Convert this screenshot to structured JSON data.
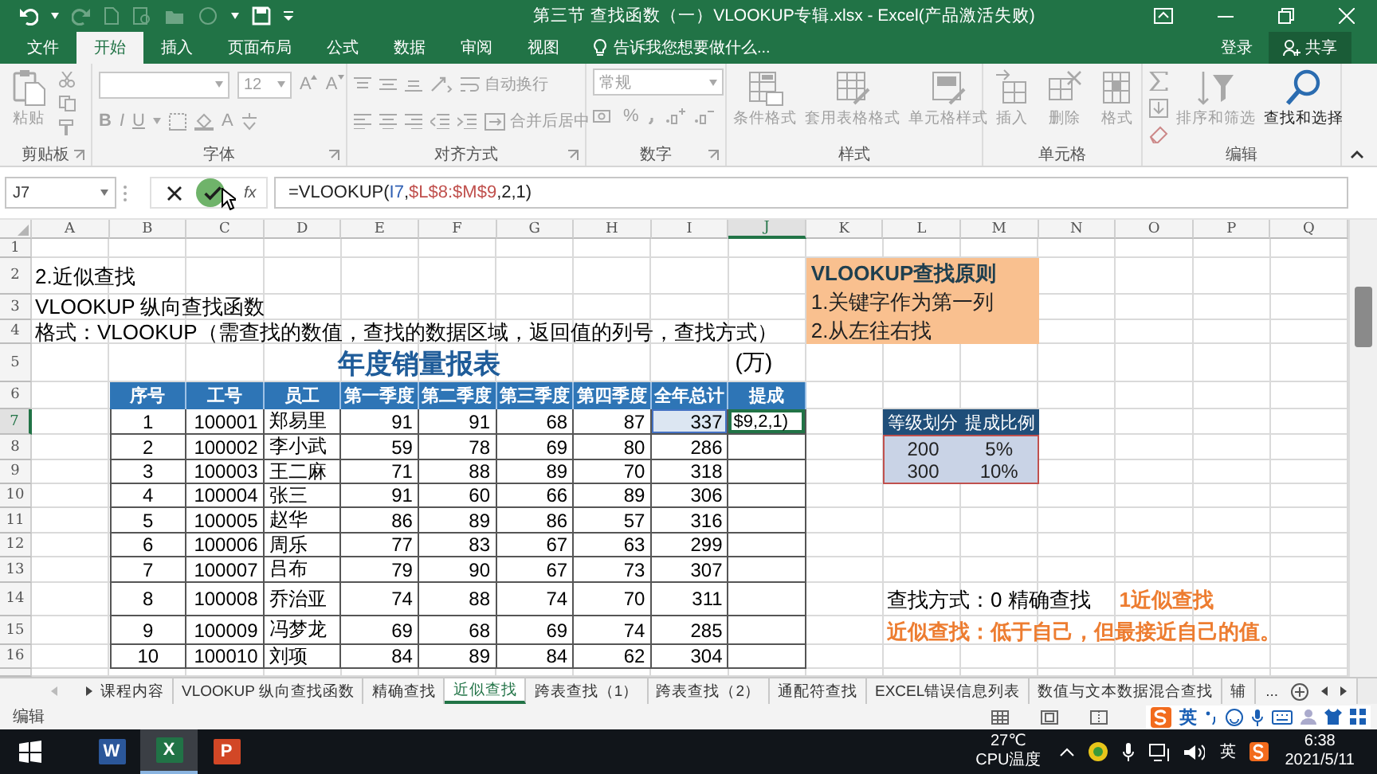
{
  "title_bar": {
    "title": "第三节 查找函数（一）VLOOKUP专辑.xlsx - Excel(产品激活失败)"
  },
  "ribbon": {
    "tabs": [
      {
        "label": "文件",
        "selected": false
      },
      {
        "label": "开始",
        "selected": true
      },
      {
        "label": "插入",
        "selected": false
      },
      {
        "label": "页面布局",
        "selected": false
      },
      {
        "label": "公式",
        "selected": false
      },
      {
        "label": "数据",
        "selected": false
      },
      {
        "label": "审阅",
        "selected": false
      },
      {
        "label": "视图",
        "selected": false
      }
    ],
    "tell_me": "告诉我您想要做什么...",
    "sign_in": "登录",
    "share": "共享",
    "groups": [
      {
        "kind": "clipboard",
        "label": "剪贴板",
        "buttons": [
          {
            "label": "粘贴",
            "disabled": true
          }
        ]
      },
      {
        "kind": "font",
        "label": "字体",
        "disabled": true,
        "font_size": "12",
        "size_buttons": [
          "A",
          "A"
        ],
        "format_buttons": [
          "B",
          "I",
          "U"
        ],
        "color_button": "A"
      },
      {
        "kind": "alignment",
        "label": "对齐方式",
        "buttons": [
          {
            "label": "自动换行",
            "disabled": true
          },
          {
            "label": "合并后居中",
            "disabled": true
          }
        ]
      },
      {
        "kind": "number",
        "label": "数字",
        "disabled": true,
        "format": "常规",
        "percent": "%"
      },
      {
        "kind": "styles",
        "label": "样式",
        "buttons": [
          {
            "label": "条件格式",
            "disabled": true
          },
          {
            "label": "套用表格格式",
            "disabled": true
          },
          {
            "label": "单元格样式",
            "disabled": true
          }
        ]
      },
      {
        "kind": "cells",
        "label": "单元格",
        "buttons": [
          {
            "label": "插入",
            "disabled": true
          },
          {
            "label": "删除",
            "disabled": true
          },
          {
            "label": "格式",
            "disabled": true
          }
        ]
      },
      {
        "kind": "editing",
        "label": "编辑",
        "buttons": [
          {
            "label": "排序和筛选",
            "disabled": true
          },
          {
            "label": "查找和选择",
            "disabled": false
          }
        ]
      }
    ]
  },
  "formula_bar": {
    "name_box": "J7",
    "function_button": "fx",
    "formula": [
      {
        "text": "=VLOOKUP("
      },
      {
        "text": "I7",
        "color": "#2f5fb3"
      },
      {
        "text": ","
      },
      {
        "text": "$L$8:$M$9",
        "color": "#c0504d"
      },
      {
        "text": ",2,1)"
      }
    ]
  },
  "sheet": {
    "column_headers": [
      {
        "label": "A",
        "selected": false
      },
      {
        "label": "B",
        "selected": false
      },
      {
        "label": "C",
        "selected": false
      },
      {
        "label": "D",
        "selected": false
      },
      {
        "label": "E",
        "selected": false
      },
      {
        "label": "F",
        "selected": false
      },
      {
        "label": "G",
        "selected": false
      },
      {
        "label": "H",
        "selected": false
      },
      {
        "label": "I",
        "selected": false
      },
      {
        "label": "J",
        "selected": true
      },
      {
        "label": "K",
        "selected": false
      },
      {
        "label": "L",
        "selected": false
      },
      {
        "label": "M",
        "selected": false
      },
      {
        "label": "N",
        "selected": false
      },
      {
        "label": "O",
        "selected": false
      },
      {
        "label": "P",
        "selected": false
      },
      {
        "label": "Q",
        "selected": false
      }
    ],
    "row_headers": [
      {
        "label": "1",
        "selected": false
      },
      {
        "label": "2",
        "selected": false
      },
      {
        "label": "3",
        "selected": false
      },
      {
        "label": "4",
        "selected": false
      },
      {
        "label": "5",
        "selected": false
      },
      {
        "label": "6",
        "selected": false
      },
      {
        "label": "7",
        "selected": true
      },
      {
        "label": "8",
        "selected": false
      },
      {
        "label": "9",
        "selected": false
      },
      {
        "label": "10",
        "selected": false
      },
      {
        "label": "11",
        "selected": false
      },
      {
        "label": "12",
        "selected": false
      },
      {
        "label": "13",
        "selected": false
      },
      {
        "label": "14",
        "selected": false
      },
      {
        "label": "15",
        "selected": false
      },
      {
        "label": "16",
        "selected": false
      }
    ],
    "notes": [
      "2.近似查找",
      "VLOOKUP 纵向查找函数",
      "格式：VLOOKUP（需查找的数值，查找的数据区域，返回值的列号，查找方式）"
    ],
    "report": {
      "title": "年度销量报表",
      "unit": "(万)",
      "columns": [
        "序号",
        "工号",
        "员工",
        "第一季度",
        "第二季度",
        "第三季度",
        "第四季度",
        "全年总计",
        "提成"
      ],
      "rows": [
        {
          "values": [
            "1",
            "100001",
            "郑易里",
            "91",
            "91",
            "68",
            "87",
            "337"
          ],
          "total_referenced": true,
          "commission": "$9,2,1)",
          "commission_active": true
        },
        {
          "values": [
            "2",
            "100002",
            "李小武",
            "59",
            "78",
            "69",
            "80",
            "286"
          ],
          "total_referenced": false,
          "commission_active": false
        },
        {
          "values": [
            "3",
            "100003",
            "王二麻",
            "71",
            "88",
            "89",
            "70",
            "318"
          ],
          "total_referenced": false,
          "commission_active": false
        },
        {
          "values": [
            "4",
            "100004",
            "张三",
            "91",
            "60",
            "66",
            "89",
            "306"
          ],
          "total_referenced": false,
          "commission_active": false
        },
        {
          "values": [
            "5",
            "100005",
            "赵华",
            "86",
            "89",
            "86",
            "57",
            "316"
          ],
          "total_referenced": false,
          "commission_active": false
        },
        {
          "values": [
            "6",
            "100006",
            "周乐",
            "77",
            "83",
            "67",
            "63",
            "299"
          ],
          "total_referenced": false,
          "commission_active": false
        },
        {
          "values": [
            "7",
            "100007",
            "吕布",
            "79",
            "90",
            "67",
            "73",
            "307"
          ],
          "total_referenced": false,
          "commission_active": false
        },
        {
          "values": [
            "8",
            "100008",
            "乔治亚",
            "74",
            "88",
            "74",
            "70",
            "311"
          ],
          "total_referenced": false,
          "commission_active": false
        },
        {
          "values": [
            "9",
            "100009",
            "冯梦龙",
            "69",
            "68",
            "69",
            "74",
            "285"
          ],
          "total_referenced": false,
          "commission_active": false
        },
        {
          "values": [
            "10",
            "100010",
            "刘项",
            "84",
            "89",
            "84",
            "62",
            "304"
          ],
          "total_referenced": false,
          "commission_active": false
        }
      ]
    },
    "principle_box": {
      "title": "VLOOKUP查找原则",
      "lines": [
        "1.关键字作为第一列",
        "2.从左往右找"
      ]
    },
    "grade_table": {
      "columns": [
        "等级划分",
        "提成比例"
      ],
      "rows": [
        [
          "200",
          "5%"
        ],
        [
          "300",
          "10%"
        ]
      ],
      "referenced": true
    },
    "lookup_notes": {
      "mode_label": "查找方式：0 精确查找",
      "approx_label": "1近似查找",
      "rule": "近似查找：低于自己，但最接近自己的值。"
    }
  },
  "sheet_tabs": {
    "tabs": [
      {
        "label": "课程内容",
        "selected": false
      },
      {
        "label": "VLOOKUP 纵向查找函数",
        "selected": false
      },
      {
        "label": "精确查找",
        "selected": false
      },
      {
        "label": "近似查找",
        "selected": true
      },
      {
        "label": "跨表查找（1）",
        "selected": false
      },
      {
        "label": "跨表查找（2）",
        "selected": false
      },
      {
        "label": "通配符查找",
        "selected": false
      },
      {
        "label": "EXCEL错误信息列表",
        "selected": false
      },
      {
        "label": "数值与文本数据混合查找",
        "selected": false
      },
      {
        "label": "辅",
        "selected": false
      }
    ],
    "more": "..."
  },
  "status_bar": {
    "mode": "编辑",
    "ime": "英"
  },
  "taskbar": {
    "apps": [
      {
        "glyph": "W",
        "color": "#2b579a",
        "selected": false
      },
      {
        "glyph": "X",
        "color": "#217346",
        "selected": true
      },
      {
        "glyph": "P",
        "color": "#d24726",
        "selected": false
      }
    ],
    "temperature": "27℃",
    "sensor": "CPU温度",
    "ime": "英",
    "time": "6:38",
    "date": "2021/5/11"
  }
}
